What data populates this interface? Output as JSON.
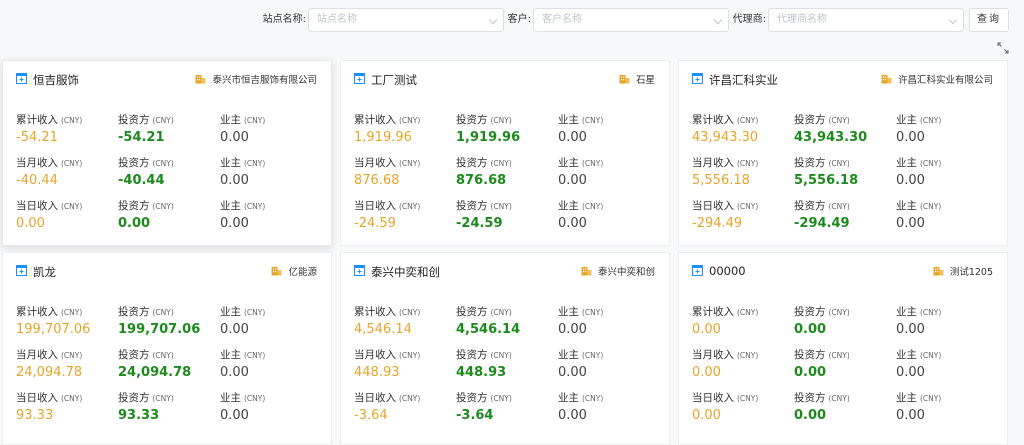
{
  "filters": {
    "site_label": "站点名称:",
    "site_placeholder": "站点名称",
    "customer_label": "客户:",
    "customer_placeholder": "客户名称",
    "agent_label": "代理商:",
    "agent_placeholder": "代理商名称",
    "query_button": "查询"
  },
  "colors": {
    "accent": "#1890ff",
    "income": "#e4a52b",
    "investor": "#1d8a1d",
    "owner_icon": "#e4a52b"
  },
  "labels": {
    "total_income": "累计收入",
    "month_income": "当月收入",
    "day_income": "当日收入",
    "investor": "投资方",
    "owner": "业主",
    "unit": "(CNY)"
  },
  "cards": [
    {
      "title": "恒吉服饰",
      "owner": "泰兴市恒吉服饰有限公司",
      "rows": [
        {
          "income": "-54.21",
          "investor": "-54.21",
          "owner": "0.00"
        },
        {
          "income": "-40.44",
          "investor": "-40.44",
          "owner": "0.00"
        },
        {
          "income": "0.00",
          "investor": "0.00",
          "owner": "0.00"
        }
      ]
    },
    {
      "title": "工厂测试",
      "owner": "石星",
      "rows": [
        {
          "income": "1,919.96",
          "investor": "1,919.96",
          "owner": "0.00"
        },
        {
          "income": "876.68",
          "investor": "876.68",
          "owner": "0.00"
        },
        {
          "income": "-24.59",
          "investor": "-24.59",
          "owner": "0.00"
        }
      ]
    },
    {
      "title": "许昌汇科实业",
      "owner": "许昌汇科实业有限公司",
      "rows": [
        {
          "income": "43,943.30",
          "investor": "43,943.30",
          "owner": "0.00"
        },
        {
          "income": "5,556.18",
          "investor": "5,556.18",
          "owner": "0.00"
        },
        {
          "income": "-294.49",
          "investor": "-294.49",
          "owner": "0.00"
        }
      ]
    },
    {
      "title": "凯龙",
      "owner": "亿能源",
      "rows": [
        {
          "income": "199,707.06",
          "investor": "199,707.06",
          "owner": "0.00"
        },
        {
          "income": "24,094.78",
          "investor": "24,094.78",
          "owner": "0.00"
        },
        {
          "income": "93.33",
          "investor": "93.33",
          "owner": "0.00"
        }
      ]
    },
    {
      "title": "泰兴中奕和创",
      "owner": "泰兴中奕和创",
      "rows": [
        {
          "income": "4,546.14",
          "investor": "4,546.14",
          "owner": "0.00"
        },
        {
          "income": "448.93",
          "investor": "448.93",
          "owner": "0.00"
        },
        {
          "income": "-3.64",
          "investor": "-3.64",
          "owner": "0.00"
        }
      ]
    },
    {
      "title": "00000",
      "owner": "测试1205",
      "rows": [
        {
          "income": "0.00",
          "investor": "0.00",
          "owner": "0.00"
        },
        {
          "income": "0.00",
          "investor": "0.00",
          "owner": "0.00"
        },
        {
          "income": "0.00",
          "investor": "0.00",
          "owner": "0.00"
        }
      ]
    }
  ]
}
